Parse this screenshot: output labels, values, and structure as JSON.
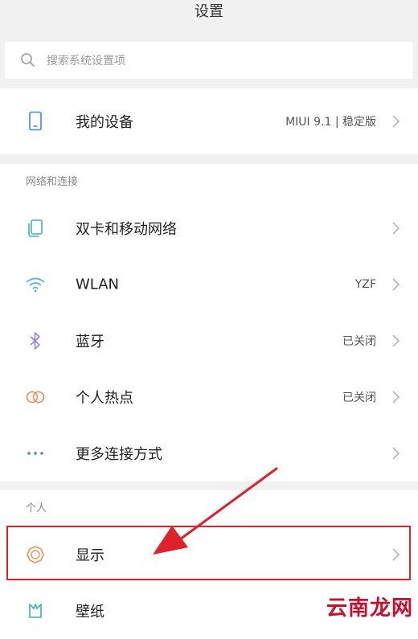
{
  "header": {
    "title": "设置"
  },
  "search": {
    "placeholder": "搜索系统设置项"
  },
  "device": {
    "label": "我的设备",
    "value": "MIUI 9.1 | 稳定版"
  },
  "network_section": {
    "title": "网络和连接",
    "items": [
      {
        "label": "双卡和移动网络",
        "value": "",
        "icon": "sim-cards-icon",
        "color": "#3fb8a8"
      },
      {
        "label": "WLAN",
        "value": "YZF",
        "icon": "wifi-icon",
        "color": "#4ab3e6"
      },
      {
        "label": "蓝牙",
        "value": "已关闭",
        "icon": "bluetooth-icon",
        "color": "#9b7de8"
      },
      {
        "label": "个人热点",
        "value": "已关闭",
        "icon": "hotspot-icon",
        "color": "#f08a5d"
      },
      {
        "label": "更多连接方式",
        "value": "",
        "icon": "more-dots-icon",
        "color": "#3d8be0"
      }
    ]
  },
  "personal_section": {
    "title": "个人",
    "items": [
      {
        "label": "显示",
        "value": "",
        "icon": "display-brightness-icon",
        "color": "#f0925a"
      },
      {
        "label": "壁纸",
        "value": "",
        "icon": "wallpaper-icon",
        "color": "#38b6a0"
      }
    ]
  },
  "watermark": "云南龙网",
  "colors": {
    "highlight": "#e0202a",
    "background": "#f1f1f1"
  }
}
